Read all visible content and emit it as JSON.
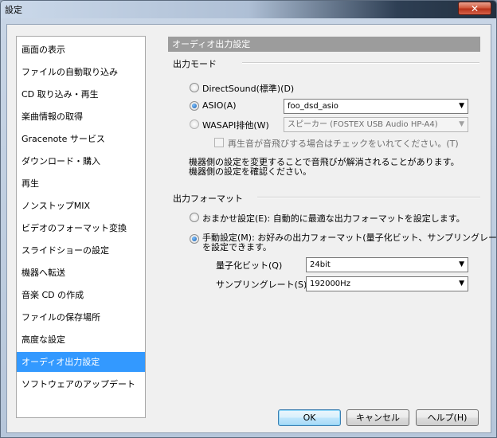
{
  "window": {
    "title": "設定",
    "close_label": "✕"
  },
  "sidebar": {
    "items": [
      {
        "label": "画面の表示"
      },
      {
        "label": "ファイルの自動取り込み"
      },
      {
        "label": "CD 取り込み・再生"
      },
      {
        "label": "楽曲情報の取得"
      },
      {
        "label": "Gracenote サービス"
      },
      {
        "label": "ダウンロード・購入"
      },
      {
        "label": "再生"
      },
      {
        "label": "ノンストップMIX"
      },
      {
        "label": "ビデオのフォーマット変換"
      },
      {
        "label": "スライドショーの設定"
      },
      {
        "label": "機器へ転送"
      },
      {
        "label": "音楽 CD の作成"
      },
      {
        "label": "ファイルの保存場所"
      },
      {
        "label": "高度な設定"
      },
      {
        "label": "オーディオ出力設定",
        "selected": true
      },
      {
        "label": "ソフトウェアのアップデート"
      }
    ]
  },
  "panel": {
    "title": "オーディオ出力設定",
    "output_mode": {
      "label": "出力モード",
      "directsound_label": "DirectSound(標準)(D)",
      "asio_label": "ASIO(A)",
      "asio_value": "foo_dsd_asio",
      "wasapi_label": "WASAPI排他(W)",
      "wasapi_value": "スピーカー (FOSTEX USB Audio HP-A4)",
      "check_label": "再生音が音飛びする場合はチェックをいれてください。(T)",
      "note_line1": "機器側の設定を変更することで音飛びが解消されることがあります。",
      "note_line2": "機器側の設定を確認ください。",
      "selected": "asio"
    },
    "output_format": {
      "label": "出力フォーマット",
      "auto_label": "おまかせ設定(E):  自動的に最適な出力フォーマットを設定します。",
      "manual_line1": "手動設定(M):  お好みの出力フォーマット(量子化ビット、サンプリングレート)",
      "manual_line2": "を設定できます。",
      "bit_label": "量子化ビット(Q)",
      "bit_value": "24bit",
      "rate_label": "サンプリングレート(S)",
      "rate_value": "192000Hz",
      "selected": "manual"
    }
  },
  "buttons": {
    "ok": "OK",
    "cancel": "キャンセル",
    "help": "ヘルプ(H)"
  },
  "colors": {
    "selection": "#3399ff",
    "header_bar": "#9c9c9c"
  }
}
